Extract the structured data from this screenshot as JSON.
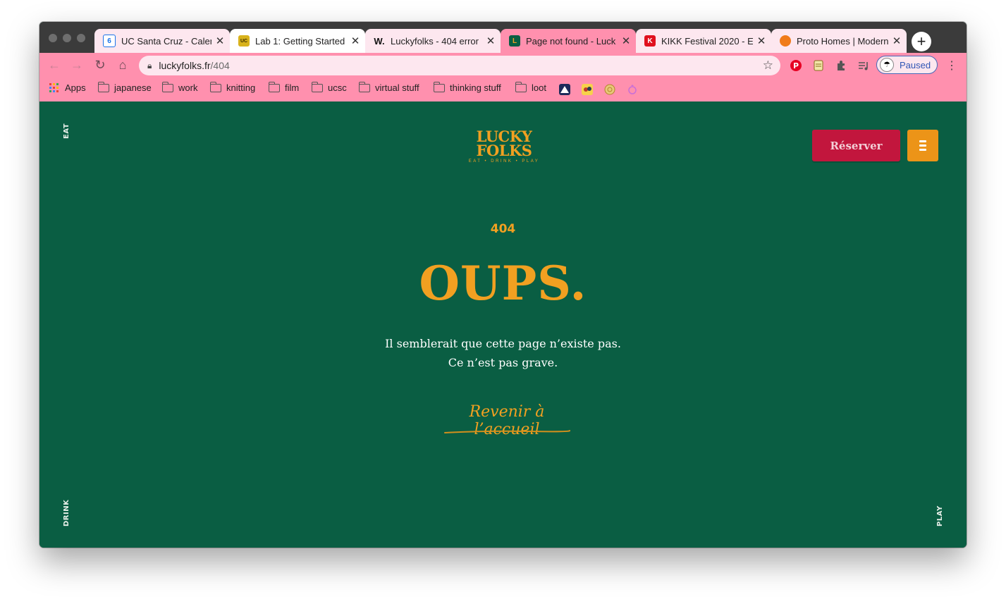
{
  "browser": {
    "tabs": [
      {
        "title": "UC Santa Cruz - Calen",
        "favicon": "calendar-icon",
        "state": "normal"
      },
      {
        "title": "Lab 1: Getting Started",
        "favicon": "ucsc-icon",
        "state": "inactive"
      },
      {
        "title": "Luckyfolks - 404 error",
        "favicon": "w-icon",
        "state": "normal"
      },
      {
        "title": "Page not found - Luck",
        "favicon": "luckyfolks-icon",
        "state": "active"
      },
      {
        "title": "KIKK Festival 2020 - E",
        "favicon": "kikk-icon",
        "state": "normal"
      },
      {
        "title": "Proto Homes | Modern",
        "favicon": "proto-icon",
        "state": "normal"
      }
    ],
    "new_tab": "+",
    "tab_close": "✕",
    "omnibox": {
      "url_host": "luckyfolks.fr",
      "url_path": "/404"
    },
    "profile_status": "Paused",
    "bookmarks": [
      {
        "label": "Apps",
        "type": "apps"
      },
      {
        "label": "japanese",
        "type": "folder"
      },
      {
        "label": "work",
        "type": "folder"
      },
      {
        "label": "knitting",
        "type": "folder"
      },
      {
        "label": "film",
        "type": "folder"
      },
      {
        "label": "ucsc",
        "type": "folder"
      },
      {
        "label": "virtual stuff",
        "type": "folder"
      },
      {
        "label": "thinking stuff",
        "type": "folder"
      },
      {
        "label": "loot",
        "type": "folder"
      }
    ],
    "colors": {
      "chrome_pink": "#ff90ae",
      "tab_strip": "#3b3b3b"
    }
  },
  "page": {
    "side_labels": {
      "top_left": "EAT",
      "bottom_left": "DRINK",
      "bottom_right": "PLAY"
    },
    "logo": {
      "line1": "LUCKY",
      "line2": "FOLKS",
      "tagline": "EAT • DRINK • PLAY"
    },
    "reserve_label": "Réserver",
    "error_code": "404",
    "headline": "OUPS.",
    "message_line1": "Il semblerait que cette page n’existe pas.",
    "message_line2": "Ce n’est pas grave.",
    "back_link": "Revenir à l’accueil",
    "colors": {
      "background": "#0a5e43",
      "accent": "#f1a021",
      "reserve": "#c2163d",
      "menu": "#ec9418"
    }
  }
}
